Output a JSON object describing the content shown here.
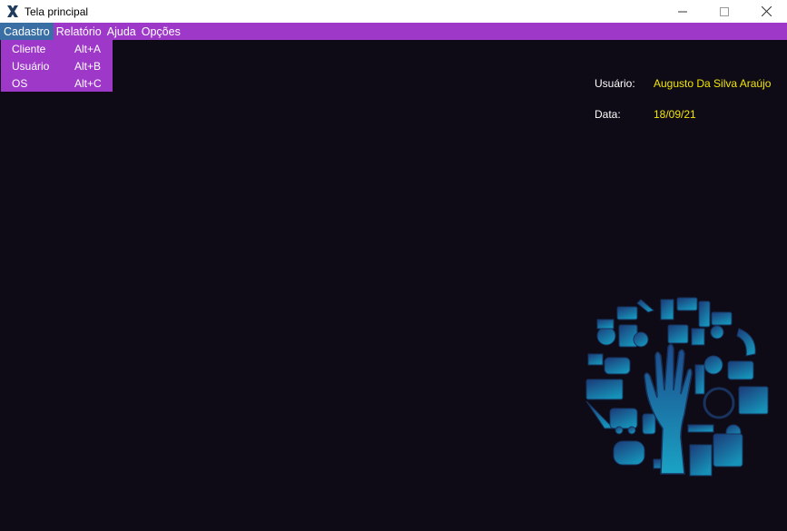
{
  "window": {
    "title": "Tela principal",
    "app_icon": "x-logo-icon",
    "controls": {
      "minimize": "─",
      "maximize": "☐",
      "close": "✕"
    }
  },
  "menubar": {
    "items": [
      {
        "label": "Cadastro"
      },
      {
        "label": "Relatório"
      },
      {
        "label": "Ajuda"
      },
      {
        "label": "Opções"
      }
    ]
  },
  "dropdown": {
    "items": [
      {
        "label": "Cliente",
        "shortcut": "Alt+A"
      },
      {
        "label": "Usuário",
        "shortcut": "Alt+B"
      },
      {
        "label": "OS",
        "shortcut": "Alt+C"
      }
    ]
  },
  "info": {
    "user_label": "Usuário:",
    "user_value": "Augusto Da Silva Araújo",
    "date_label": "Data:",
    "date_value": "18/09/21"
  },
  "colors": {
    "background": "#0e0b16",
    "menu": "#9d38c9",
    "menu_active": "#3a6fa5",
    "value_text": "#f2e600"
  },
  "logo": {
    "icon": "hand-tree-technology-icon"
  }
}
